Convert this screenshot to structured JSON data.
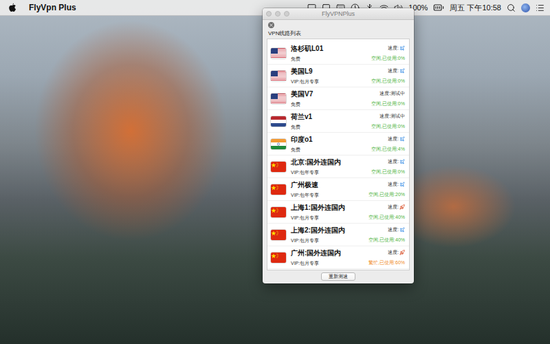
{
  "menu_bar": {
    "app_name": "FlyVpn Plus",
    "battery": "100%",
    "clock": "周五 下午10:58"
  },
  "window": {
    "title": "FlyVPNPlus",
    "active": false
  },
  "panel": {
    "title": "VPN线路列表"
  },
  "servers": [
    {
      "name": "洛杉矶L01",
      "plan": "免费",
      "flag": "us",
      "speed_label": "速度:",
      "speed_kind": "plane",
      "status": "空闲,已使用:0%",
      "color": "#4cb33c"
    },
    {
      "name": "美国L9",
      "plan": "VIP:包月专享",
      "flag": "us",
      "speed_label": "速度:",
      "speed_kind": "plane",
      "status": "空闲,已使用:0%",
      "color": "#4cb33c"
    },
    {
      "name": "美国V7",
      "plan": "免费",
      "flag": "us",
      "speed_label": "速度:测试中",
      "speed_kind": "testing",
      "status": "空闲,已使用:0%",
      "color": "#4cb33c"
    },
    {
      "name": "荷兰v1",
      "plan": "免费",
      "flag": "nl",
      "speed_label": "速度:测试中",
      "speed_kind": "testing",
      "status": "空闲,已使用:0%",
      "color": "#4cb33c"
    },
    {
      "name": "印度o1",
      "plan": "免费",
      "flag": "in",
      "speed_label": "速度:",
      "speed_kind": "plane",
      "status": "空闲,已使用:4%",
      "color": "#4cb33c"
    },
    {
      "name": "北京:国外连国内",
      "plan": "VIP:包年专享",
      "flag": "cn",
      "speed_label": "速度:",
      "speed_kind": "plane",
      "status": "空闲,已使用:0%",
      "color": "#4cb33c"
    },
    {
      "name": "广州极速",
      "plan": "VIP:包年专享",
      "flag": "cn",
      "speed_label": "速度:",
      "speed_kind": "plane",
      "status": "空闲,已使用:20%",
      "color": "#4cb33c"
    },
    {
      "name": "上海1:国外连国内",
      "plan": "VIP:包月专享",
      "flag": "cn",
      "speed_label": "速度:",
      "speed_kind": "rocket",
      "status": "空闲,已使用:40%",
      "color": "#4cb33c"
    },
    {
      "name": "上海2:国外连国内",
      "plan": "VIP:包月专享",
      "flag": "cn",
      "speed_label": "速度:",
      "speed_kind": "plane",
      "status": "空闲,已使用:40%",
      "color": "#4cb33c"
    },
    {
      "name": "广州:国外连国内",
      "plan": "VIP:包月专享",
      "flag": "cn",
      "speed_label": "速度:",
      "speed_kind": "rocket",
      "status": "繁忙,已使用:60%",
      "color": "#f08a24"
    }
  ],
  "buttons": [
    "重新测速"
  ]
}
